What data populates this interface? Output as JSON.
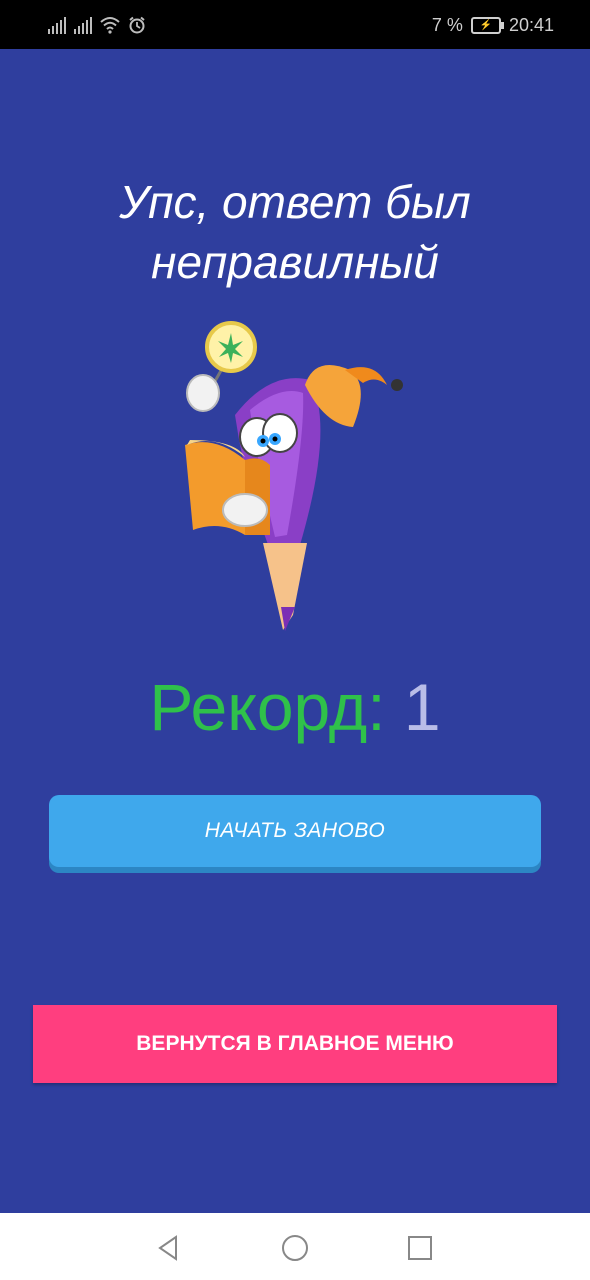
{
  "status_bar": {
    "battery": "7 %",
    "time": "20:41",
    "icons": [
      "signal-icon",
      "signal-icon",
      "wifi-icon",
      "alarm-icon",
      "battery-charging-icon"
    ]
  },
  "screen": {
    "title": "Упс, ответ был неправилный",
    "record_label": "Рекорд: ",
    "record_value": "1",
    "restart_button": "НАЧАТЬ ЗАНОВО",
    "menu_button": "ВЕРНУТСЯ В ГЛАВНОЕ МЕНЮ",
    "mascot": "pencil-wizard-reading-book"
  },
  "colors": {
    "background": "#2f3e9e",
    "record_label": "#2fc14a",
    "record_value": "#b9bde8",
    "restart_button": "#3fa8ec",
    "menu_button": "#ff3e7f"
  },
  "nav_bar": {
    "icons": [
      "back-icon",
      "home-icon",
      "recents-icon"
    ]
  }
}
